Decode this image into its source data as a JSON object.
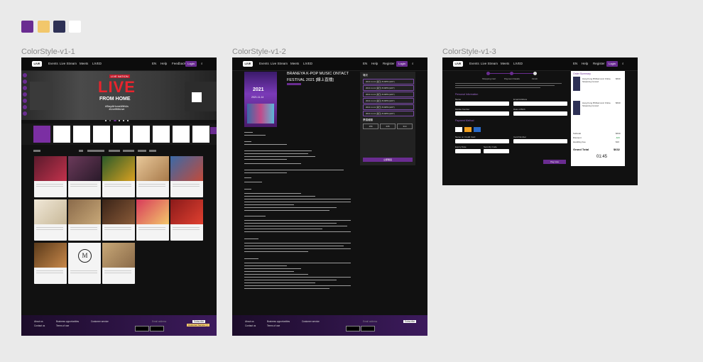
{
  "palette": [
    "#6a2c91",
    "#f2c76b",
    "#2e3156",
    "#ffffff"
  ],
  "frames": [
    {
      "label": "ColorStyle-v1-1"
    },
    {
      "label": "ColorStyle-v1-2"
    },
    {
      "label": "ColorStyle-v1-3"
    }
  ],
  "nav1": {
    "items": [
      "Events",
      "Live Stream",
      "Meets",
      "LIVED"
    ],
    "right": [
      "EN",
      "Help",
      "Feedback"
    ],
    "login": "Login"
  },
  "nav2": {
    "items": [
      "Events",
      "Live Stream",
      "Meets",
      "LIVED"
    ],
    "right": [
      "EN",
      "Help",
      "Register"
    ],
    "login": "Login"
  },
  "nav3": {
    "items": [
      "Events",
      "Live Stream",
      "Meets",
      "LIVED"
    ],
    "right": [
      "EN",
      "Help",
      "Register"
    ],
    "login": "Login"
  },
  "hero": {
    "title": "LIVE",
    "subtitle": "FROM HOME",
    "tag": "LIVE NATION",
    "hashtags": "#StayAtHomeWithUs\n#LiveWithLive"
  },
  "footer": {
    "about": "About us",
    "contact": "Contact us",
    "biz": "Business opportunities",
    "terms": "Terms of use",
    "cs": "Customer service",
    "email_ph": "Email address",
    "subscribe": "Subscribe",
    "cookie": "Customer Service ⓘ"
  },
  "event": {
    "title_line1": "BRANEYA K-POP MUSIC ONTACT",
    "title_line2": "FESTIVAL 2021 [線上直播]",
    "poster_year": "2021",
    "poster_date": "2021.11.14",
    "session_label": "場次",
    "ticket_label": "票價種類",
    "prices": [
      "156",
      "235",
      "314"
    ],
    "buy": "立即購買",
    "slots": [
      "2021.11.14 (週日) 8:00PM (HKT)",
      "2021.11.14 (週日) 8:00PM (HKT)",
      "2021.11.14 (週日) 8:00PM (HKT)",
      "2021.11.14 (週日) 8:00PM (HKT)",
      "2021.11.14 (週日) 8:00PM (HKT)",
      "2021.11.14 (週日) 8:00PM (HKT)"
    ]
  },
  "checkout": {
    "steps": [
      "Shopping Cart",
      "Payment Details",
      "Finish"
    ],
    "personal": "Personal Information",
    "labels": [
      "Name",
      "Email Address",
      "Mobile Number",
      "Date of Birth"
    ],
    "payment": "Payment Method",
    "card_labels": [
      "Name on Credit Card",
      "Card Number",
      "Expiry Date",
      "Security Code"
    ],
    "summary": "Order Summary",
    "items": [
      {
        "name": "Hong Kong Philharmonic Online Streaming Concert",
        "price": "$630"
      },
      {
        "name": "Hong Kong Philharmonic Online Streaming Concert",
        "price": "$630"
      }
    ],
    "subtotal_label": "Subtotal",
    "subtotal": "$630",
    "discount_label": "Discount",
    "discount": "-$46",
    "fee_label": "Handling Fee",
    "fee": "$16",
    "total_label": "Grand Total",
    "total": "$632",
    "timer": "01:45",
    "pay": "Pay now"
  }
}
